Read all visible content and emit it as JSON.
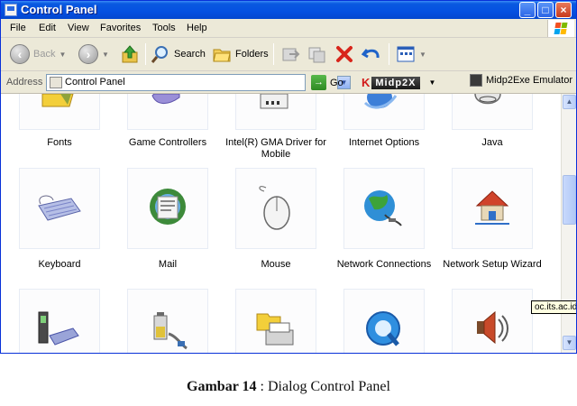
{
  "window": {
    "title": "Control Panel",
    "controls": {
      "minimize": "_",
      "maximize": "□",
      "close": "×"
    }
  },
  "menu": [
    "File",
    "Edit",
    "View",
    "Favorites",
    "Tools",
    "Help"
  ],
  "toolbar": {
    "back": "Back",
    "search": "Search",
    "folders": "Folders"
  },
  "address": {
    "label": "Address",
    "value": "Control Panel",
    "go": "Go",
    "midpx": "Midp2X",
    "midp2exe": "Midp2Exe Emulator"
  },
  "items": {
    "row1": [
      "Fonts",
      "Game Controllers",
      "Intel(R) GMA Driver for Mobile",
      "Internet Options",
      "Java"
    ],
    "row2": [
      "Keyboard",
      "Mail",
      "Mouse",
      "Network Connections",
      "Network Setup Wizard"
    ]
  },
  "row3_icons": [
    "phone-modem-icon",
    "power-options-icon",
    "printers-faxes-icon",
    "quicktime-icon",
    "sounds-audio-icon"
  ],
  "tooltip": "oc.its.ac.id",
  "caption": {
    "label": "Gambar 14",
    "text": " : Dialog Control Panel"
  },
  "colors": {
    "titlebar": "#0450e1",
    "chrome": "#ece9d8",
    "content": "#ffffff"
  }
}
